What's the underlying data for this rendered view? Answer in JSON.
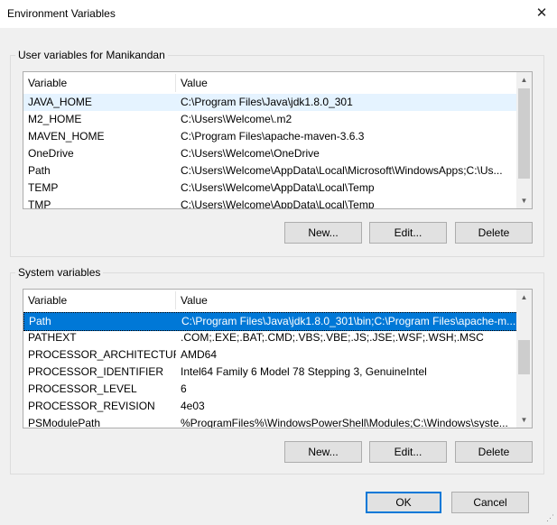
{
  "window": {
    "title": "Environment Variables",
    "close_glyph": "✕"
  },
  "user_vars": {
    "legend": "User variables for Manikandan",
    "columns": [
      "Variable",
      "Value"
    ],
    "rows": [
      [
        "JAVA_HOME",
        "C:\\Program Files\\Java\\jdk1.8.0_301"
      ],
      [
        "M2_HOME",
        "C:\\Users\\Welcome\\.m2"
      ],
      [
        "MAVEN_HOME",
        "C:\\Program Files\\apache-maven-3.6.3"
      ],
      [
        "OneDrive",
        "C:\\Users\\Welcome\\OneDrive"
      ],
      [
        "Path",
        "C:\\Users\\Welcome\\AppData\\Local\\Microsoft\\WindowsApps;C:\\Us..."
      ],
      [
        "TEMP",
        "C:\\Users\\Welcome\\AppData\\Local\\Temp"
      ],
      [
        "TMP",
        "C:\\Users\\Welcome\\AppData\\Local\\Temp"
      ]
    ],
    "buttons": {
      "new": "New...",
      "edit": "Edit...",
      "delete": "Delete"
    }
  },
  "system_vars": {
    "legend": "System variables",
    "columns": [
      "Variable",
      "Value"
    ],
    "rows": [
      [
        "Path",
        "C:\\Program Files\\Java\\jdk1.8.0_301\\bin;C:\\Program Files\\apache-m..."
      ],
      [
        "PATHEXT",
        ".COM;.EXE;.BAT;.CMD;.VBS;.VBE;.JS;.JSE;.WSF;.WSH;.MSC"
      ],
      [
        "PROCESSOR_ARCHITECTURE",
        "AMD64"
      ],
      [
        "PROCESSOR_IDENTIFIER",
        "Intel64 Family 6 Model 78 Stepping 3, GenuineIntel"
      ],
      [
        "PROCESSOR_LEVEL",
        "6"
      ],
      [
        "PROCESSOR_REVISION",
        "4e03"
      ],
      [
        "PSModulePath",
        "%ProgramFiles%\\WindowsPowerShell\\Modules;C:\\Windows\\syste..."
      ]
    ],
    "buttons": {
      "new": "New...",
      "edit": "Edit...",
      "delete": "Delete"
    }
  },
  "footer": {
    "ok": "OK",
    "cancel": "Cancel"
  },
  "icons": {
    "scroll_up": "▲",
    "scroll_down": "▼",
    "close": "close-icon",
    "resize_grip": "⋰"
  },
  "colors": {
    "selection": "#0078d7",
    "hover": "#e5f3ff",
    "default_button_border": "#0078d7"
  }
}
